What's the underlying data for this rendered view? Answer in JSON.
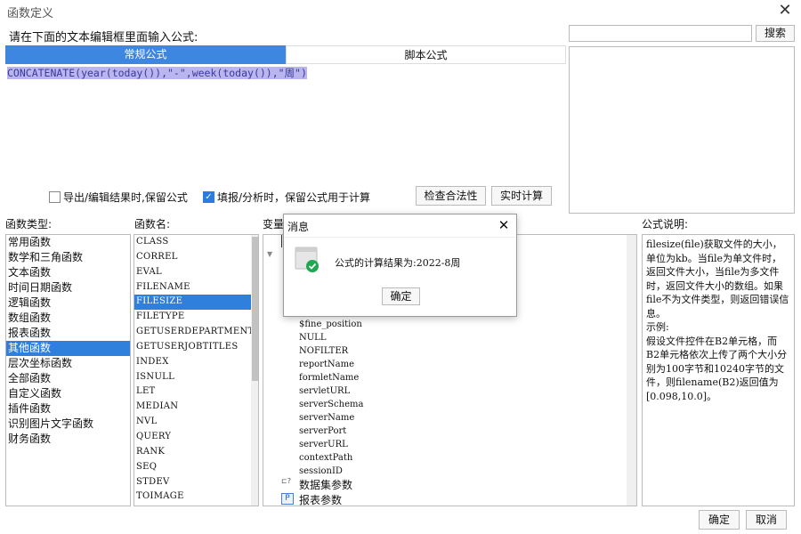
{
  "window": {
    "title": "函数定义",
    "close_glyph": "✕"
  },
  "prompt": "请在下面的文本编辑框里面输入公式:",
  "tabs": {
    "regular": "常规公式",
    "script": "脚本公式"
  },
  "editor": {
    "formula": "CONCATENATE(year(today()),\"-\",week(today()),\"周\")"
  },
  "search": {
    "value": "",
    "button": "搜索"
  },
  "options": {
    "keep_on_export": {
      "label": "导出/编辑结果时,保留公式",
      "checked": false
    },
    "keep_on_fill": {
      "label": "填报/分析时，保留公式用于计算",
      "checked": true
    }
  },
  "buttons": {
    "check": "检查合法性",
    "realtime": "实时计算",
    "ok": "确定",
    "cancel": "取消"
  },
  "labels": {
    "func_type": "函数类型:",
    "func_name": "函数名:",
    "variables": "变量",
    "description": "公式说明:"
  },
  "func_types": [
    "常用函数",
    "数学和三角函数",
    "文本函数",
    "时间日期函数",
    "逻辑函数",
    "数组函数",
    "报表函数",
    "其他函数",
    "层次坐标函数",
    "全部函数",
    "自定义函数",
    "插件函数",
    "识别图片文字函数",
    "财务函数"
  ],
  "func_types_selected": 7,
  "func_names": [
    "CLASS",
    "CORREL",
    "EVAL",
    "FILENAME",
    "FILESIZE",
    "FILETYPE",
    "GETUSERDEPARTMENTS",
    "GETUSERJOBTITLES",
    "INDEX",
    "ISNULL",
    "LET",
    "MEDIAN",
    "NVL",
    "QUERY",
    "RANK",
    "SEQ",
    "STDEV",
    "TOIMAGE"
  ],
  "func_names_selected": 4,
  "variables": [
    "$fine_position",
    "NULL",
    "NOFILTER",
    "reportName",
    "formletName",
    "servletURL",
    "serverSchema",
    "serverName",
    "serverPort",
    "serverURL",
    "contextPath",
    "sessionID"
  ],
  "tree_nodes": {
    "dataset_params": "数据集参数",
    "report_params": "报表参数"
  },
  "description": {
    "main": "filesize(file)获取文件的大小，单位为kb。当file为单文件时，返回文件大小，当file为多文件时，返回文件大小的数组。如果file不为文件类型，则返回错误信息。",
    "example_label": "示例:",
    "example": "假设文件控件在B2单元格，而B2单元格依次上传了两个大小分别为100字节和10240字节的文件，则filename(B2)返回值为[0.098,10.0]。"
  },
  "dialog": {
    "title": "消息",
    "message": "公式的计算结果为:2022-8周",
    "ok": "确定",
    "close_glyph": "✕"
  },
  "icons": {
    "success": "check-circle-icon",
    "accent": "#2f7fdc",
    "success_color": "#1fa851"
  }
}
